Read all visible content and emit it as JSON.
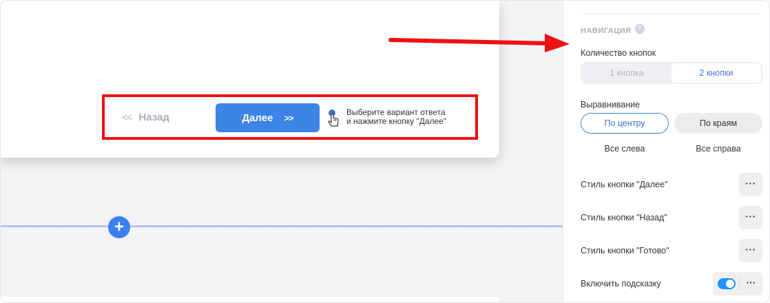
{
  "preview": {
    "back_label": "Назад",
    "back_chevron": "<<",
    "next_label": "Далее",
    "next_chevron": ">>",
    "hint_icon": "pointer-hand-icon",
    "hint_line1": "Выберите вариант ответа",
    "hint_line2": "и нажмите кнопку \"Далее\"",
    "add_icon": "plus-icon",
    "add_symbol": "+"
  },
  "annotation": {
    "arrow_color": "#ee1111",
    "highlight_color": "#ee1111"
  },
  "panel": {
    "section_title": "НАВИГАЦИЯ",
    "help_symbol": "?",
    "buttons_count_label": "Количество кнопок",
    "buttons_count_options": [
      "1 кнопка",
      "2 кнопки"
    ],
    "buttons_count_selected": "2 кнопки",
    "alignment_label": "Выравнивание",
    "alignment_options": [
      "По центру",
      "По краям",
      "Все слева",
      "Все справа"
    ],
    "alignment_selected": "По центру",
    "style_next_label": "Стиль кнопки \"Далее\"",
    "style_back_label": "Стиль кнопки \"Назад\"",
    "style_done_label": "Стиль кнопки \"Готово\"",
    "hint_toggle_label": "Включить подсказку",
    "hint_toggle_on": true,
    "dots_symbol": "···"
  },
  "colors": {
    "accent": "#3c84e6",
    "toggle_on": "#1e90ff"
  }
}
